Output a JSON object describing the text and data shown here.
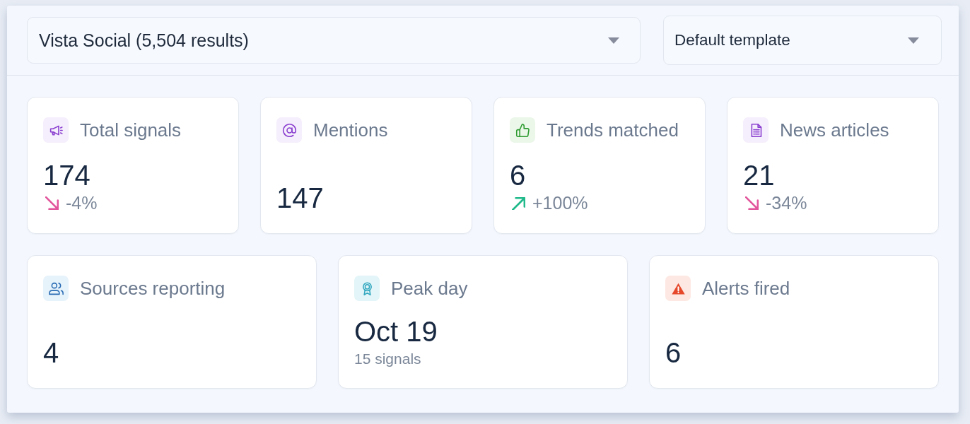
{
  "filters": [
    {
      "value": "Vista Social (5,504 results)"
    },
    {
      "value": "Default template"
    }
  ],
  "stat_rows": [
    {
      "cards": [
        {
          "kind": "signals",
          "label": "Total signals",
          "value": "174",
          "change": {
            "text": "-4%",
            "increase": false
          }
        },
        {
          "kind": "mentions",
          "label": "Mentions",
          "value": "147"
        },
        {
          "kind": "trends",
          "label": "Trends matched",
          "value": "6",
          "change": {
            "text": "+100%",
            "increase": true
          }
        },
        {
          "kind": "news",
          "label": "News articles",
          "value": "21",
          "change": {
            "text": "-34%",
            "increase": false
          }
        }
      ]
    },
    {
      "cards": [
        {
          "kind": "sources",
          "label": "Sources reporting",
          "value": "4"
        },
        {
          "kind": "peak",
          "label": "Peak day",
          "value": "Oct 19",
          "note": "15 signals"
        },
        {
          "kind": "alerts",
          "label": "Alerts fired",
          "value": "6"
        }
      ]
    }
  ]
}
